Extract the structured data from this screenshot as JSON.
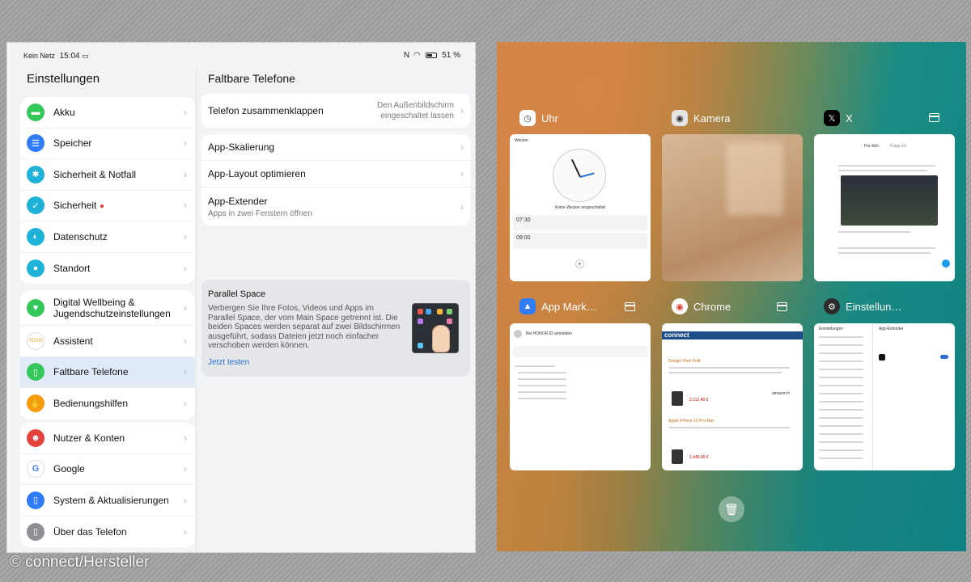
{
  "status_bar": {
    "carrier": "Kein Netz",
    "time": "15:04",
    "battery": "51 %"
  },
  "settings": {
    "title": "Einstellungen",
    "groups": [
      [
        {
          "label": "Akku",
          "color": "#34c759",
          "icon": "battery-icon"
        },
        {
          "label": "Speicher",
          "color": "#2f7cf6",
          "icon": "storage-icon"
        },
        {
          "label": "Sicherheit & Notfall",
          "color": "#1eb2d8",
          "icon": "emergency-icon"
        },
        {
          "label": "Sicherheit",
          "color": "#1eb2d8",
          "icon": "shield-icon",
          "dot": true
        },
        {
          "label": "Datenschutz",
          "color": "#1eb2d8",
          "icon": "privacy-icon"
        },
        {
          "label": "Standort",
          "color": "#1eb2d8",
          "icon": "location-icon"
        }
      ],
      [
        {
          "label": "Digital Wellbeing & Jugendschutzeinstellungen",
          "color": "#34c759",
          "icon": "wellbeing-icon"
        },
        {
          "label": "Assistent",
          "color": "#ffffff",
          "icon": "yoyo-icon"
        },
        {
          "label": "Faltbare Telefone",
          "color": "#34c759",
          "icon": "foldable-icon",
          "selected": true
        },
        {
          "label": "Bedienungshilfen",
          "color": "#f59b0c",
          "icon": "accessibility-icon"
        }
      ],
      [
        {
          "label": "Nutzer & Konten",
          "color": "#e4433d",
          "icon": "user-icon"
        },
        {
          "label": "Google",
          "color": "#ffffff",
          "icon": "google-icon"
        },
        {
          "label": "System & Aktualisierungen",
          "color": "#2f7cf6",
          "icon": "system-icon"
        },
        {
          "label": "Über das Telefon",
          "color": "#8e8e93",
          "icon": "phone-info-icon"
        }
      ]
    ]
  },
  "detail": {
    "title": "Faltbare Telefone",
    "fold_label": "Telefon zusammenklappen",
    "fold_value": "Den Außenbildschirm eingeschaltet lassen",
    "rows": [
      "App-Skalierung",
      "App-Layout optimieren"
    ],
    "extender_label": "App-Extender",
    "extender_sub": "Apps in zwei Fenstern öffnen",
    "parallel_title": "Parallel Space",
    "parallel_text": "Verbergen Sie Ihre Fotos, Videos und Apps im Parallel Space, der vom Main Space getrennt ist. Die beiden Spaces werden separat auf zwei Bildschirmen ausgeführt, sodass Dateien jetzt noch einfacher verschoben werden können.",
    "parallel_link": "Jetzt testen"
  },
  "recents": {
    "apps": [
      {
        "name": "Uhr"
      },
      {
        "name": "Kamera"
      },
      {
        "name": "X"
      },
      {
        "name": "App Mark…"
      },
      {
        "name": "Chrome"
      },
      {
        "name": "Einstellun…"
      }
    ],
    "clock": {
      "header": "Wecker",
      "no_alarm": "Keine Wecker eingeschaltet",
      "alarm1": "07:30",
      "alarm2": "09:00"
    },
    "x_thumb": {
      "tab1": "Für dich",
      "tab2": "Folge ich"
    },
    "appmarket": {
      "header": "Bei HONOR ID anmelden"
    },
    "chrome": {
      "site": "connect",
      "item1": "Google Pixel Fold",
      "price1": "2.112,48 €",
      "item2": "Apple iPhone 15 Pro Max",
      "price2": "1.449,00 €",
      "shop": "amazon.fr"
    },
    "settings_thumb": {
      "title": "Einstellungen",
      "subtitle": "App-Extender"
    }
  },
  "copyright": "© connect/Hersteller"
}
